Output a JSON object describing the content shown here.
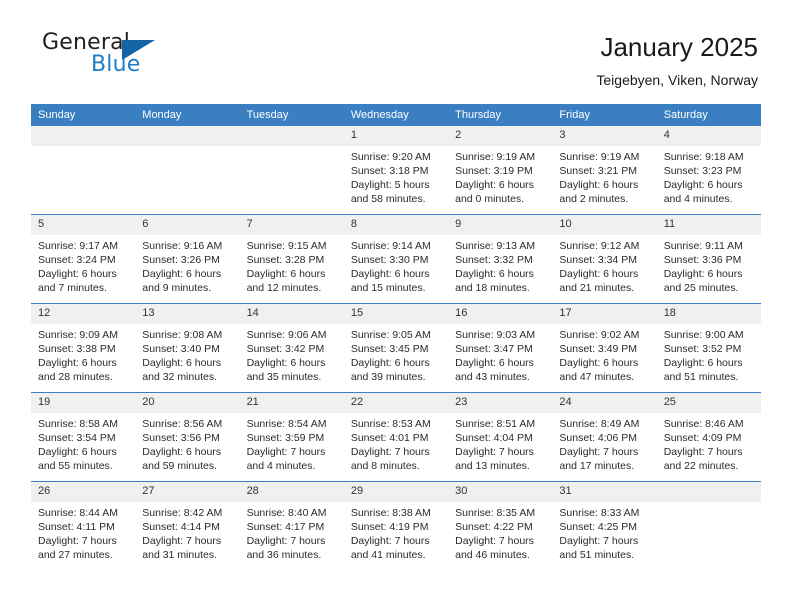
{
  "logo": {
    "word_one": "General",
    "word_two": "Blue",
    "triangle_icon": "triangle-icon",
    "accent_color": "#1464a5"
  },
  "header": {
    "title": "January 2025",
    "subtitle": "Teigebyen, Viken, Norway"
  },
  "theme": {
    "header_blue": "#3a7fc1",
    "daynum_gray": "#f0f0f0",
    "text": "#2b2b2b"
  },
  "calendar": {
    "weekday_headers": [
      "Sunday",
      "Monday",
      "Tuesday",
      "Wednesday",
      "Thursday",
      "Friday",
      "Saturday"
    ],
    "labels": {
      "sunrise": "Sunrise:",
      "sunset": "Sunset:",
      "daylight": "Daylight:"
    },
    "weeks": [
      [
        {
          "day": "",
          "empty": true
        },
        {
          "day": "",
          "empty": true
        },
        {
          "day": "",
          "empty": true
        },
        {
          "day": "1",
          "sunrise": "Sunrise: 9:20 AM",
          "sunset": "Sunset: 3:18 PM",
          "daylight_line1": "Daylight: 5 hours",
          "daylight_line2": "and 58 minutes."
        },
        {
          "day": "2",
          "sunrise": "Sunrise: 9:19 AM",
          "sunset": "Sunset: 3:19 PM",
          "daylight_line1": "Daylight: 6 hours",
          "daylight_line2": "and 0 minutes."
        },
        {
          "day": "3",
          "sunrise": "Sunrise: 9:19 AM",
          "sunset": "Sunset: 3:21 PM",
          "daylight_line1": "Daylight: 6 hours",
          "daylight_line2": "and 2 minutes."
        },
        {
          "day": "4",
          "sunrise": "Sunrise: 9:18 AM",
          "sunset": "Sunset: 3:23 PM",
          "daylight_line1": "Daylight: 6 hours",
          "daylight_line2": "and 4 minutes."
        }
      ],
      [
        {
          "day": "5",
          "sunrise": "Sunrise: 9:17 AM",
          "sunset": "Sunset: 3:24 PM",
          "daylight_line1": "Daylight: 6 hours",
          "daylight_line2": "and 7 minutes."
        },
        {
          "day": "6",
          "sunrise": "Sunrise: 9:16 AM",
          "sunset": "Sunset: 3:26 PM",
          "daylight_line1": "Daylight: 6 hours",
          "daylight_line2": "and 9 minutes."
        },
        {
          "day": "7",
          "sunrise": "Sunrise: 9:15 AM",
          "sunset": "Sunset: 3:28 PM",
          "daylight_line1": "Daylight: 6 hours",
          "daylight_line2": "and 12 minutes."
        },
        {
          "day": "8",
          "sunrise": "Sunrise: 9:14 AM",
          "sunset": "Sunset: 3:30 PM",
          "daylight_line1": "Daylight: 6 hours",
          "daylight_line2": "and 15 minutes."
        },
        {
          "day": "9",
          "sunrise": "Sunrise: 9:13 AM",
          "sunset": "Sunset: 3:32 PM",
          "daylight_line1": "Daylight: 6 hours",
          "daylight_line2": "and 18 minutes."
        },
        {
          "day": "10",
          "sunrise": "Sunrise: 9:12 AM",
          "sunset": "Sunset: 3:34 PM",
          "daylight_line1": "Daylight: 6 hours",
          "daylight_line2": "and 21 minutes."
        },
        {
          "day": "11",
          "sunrise": "Sunrise: 9:11 AM",
          "sunset": "Sunset: 3:36 PM",
          "daylight_line1": "Daylight: 6 hours",
          "daylight_line2": "and 25 minutes."
        }
      ],
      [
        {
          "day": "12",
          "sunrise": "Sunrise: 9:09 AM",
          "sunset": "Sunset: 3:38 PM",
          "daylight_line1": "Daylight: 6 hours",
          "daylight_line2": "and 28 minutes."
        },
        {
          "day": "13",
          "sunrise": "Sunrise: 9:08 AM",
          "sunset": "Sunset: 3:40 PM",
          "daylight_line1": "Daylight: 6 hours",
          "daylight_line2": "and 32 minutes."
        },
        {
          "day": "14",
          "sunrise": "Sunrise: 9:06 AM",
          "sunset": "Sunset: 3:42 PM",
          "daylight_line1": "Daylight: 6 hours",
          "daylight_line2": "and 35 minutes."
        },
        {
          "day": "15",
          "sunrise": "Sunrise: 9:05 AM",
          "sunset": "Sunset: 3:45 PM",
          "daylight_line1": "Daylight: 6 hours",
          "daylight_line2": "and 39 minutes."
        },
        {
          "day": "16",
          "sunrise": "Sunrise: 9:03 AM",
          "sunset": "Sunset: 3:47 PM",
          "daylight_line1": "Daylight: 6 hours",
          "daylight_line2": "and 43 minutes."
        },
        {
          "day": "17",
          "sunrise": "Sunrise: 9:02 AM",
          "sunset": "Sunset: 3:49 PM",
          "daylight_line1": "Daylight: 6 hours",
          "daylight_line2": "and 47 minutes."
        },
        {
          "day": "18",
          "sunrise": "Sunrise: 9:00 AM",
          "sunset": "Sunset: 3:52 PM",
          "daylight_line1": "Daylight: 6 hours",
          "daylight_line2": "and 51 minutes."
        }
      ],
      [
        {
          "day": "19",
          "sunrise": "Sunrise: 8:58 AM",
          "sunset": "Sunset: 3:54 PM",
          "daylight_line1": "Daylight: 6 hours",
          "daylight_line2": "and 55 minutes."
        },
        {
          "day": "20",
          "sunrise": "Sunrise: 8:56 AM",
          "sunset": "Sunset: 3:56 PM",
          "daylight_line1": "Daylight: 6 hours",
          "daylight_line2": "and 59 minutes."
        },
        {
          "day": "21",
          "sunrise": "Sunrise: 8:54 AM",
          "sunset": "Sunset: 3:59 PM",
          "daylight_line1": "Daylight: 7 hours",
          "daylight_line2": "and 4 minutes."
        },
        {
          "day": "22",
          "sunrise": "Sunrise: 8:53 AM",
          "sunset": "Sunset: 4:01 PM",
          "daylight_line1": "Daylight: 7 hours",
          "daylight_line2": "and 8 minutes."
        },
        {
          "day": "23",
          "sunrise": "Sunrise: 8:51 AM",
          "sunset": "Sunset: 4:04 PM",
          "daylight_line1": "Daylight: 7 hours",
          "daylight_line2": "and 13 minutes."
        },
        {
          "day": "24",
          "sunrise": "Sunrise: 8:49 AM",
          "sunset": "Sunset: 4:06 PM",
          "daylight_line1": "Daylight: 7 hours",
          "daylight_line2": "and 17 minutes."
        },
        {
          "day": "25",
          "sunrise": "Sunrise: 8:46 AM",
          "sunset": "Sunset: 4:09 PM",
          "daylight_line1": "Daylight: 7 hours",
          "daylight_line2": "and 22 minutes."
        }
      ],
      [
        {
          "day": "26",
          "sunrise": "Sunrise: 8:44 AM",
          "sunset": "Sunset: 4:11 PM",
          "daylight_line1": "Daylight: 7 hours",
          "daylight_line2": "and 27 minutes."
        },
        {
          "day": "27",
          "sunrise": "Sunrise: 8:42 AM",
          "sunset": "Sunset: 4:14 PM",
          "daylight_line1": "Daylight: 7 hours",
          "daylight_line2": "and 31 minutes."
        },
        {
          "day": "28",
          "sunrise": "Sunrise: 8:40 AM",
          "sunset": "Sunset: 4:17 PM",
          "daylight_line1": "Daylight: 7 hours",
          "daylight_line2": "and 36 minutes."
        },
        {
          "day": "29",
          "sunrise": "Sunrise: 8:38 AM",
          "sunset": "Sunset: 4:19 PM",
          "daylight_line1": "Daylight: 7 hours",
          "daylight_line2": "and 41 minutes."
        },
        {
          "day": "30",
          "sunrise": "Sunrise: 8:35 AM",
          "sunset": "Sunset: 4:22 PM",
          "daylight_line1": "Daylight: 7 hours",
          "daylight_line2": "and 46 minutes."
        },
        {
          "day": "31",
          "sunrise": "Sunrise: 8:33 AM",
          "sunset": "Sunset: 4:25 PM",
          "daylight_line1": "Daylight: 7 hours",
          "daylight_line2": "and 51 minutes."
        },
        {
          "day": "",
          "empty": true
        }
      ]
    ]
  }
}
